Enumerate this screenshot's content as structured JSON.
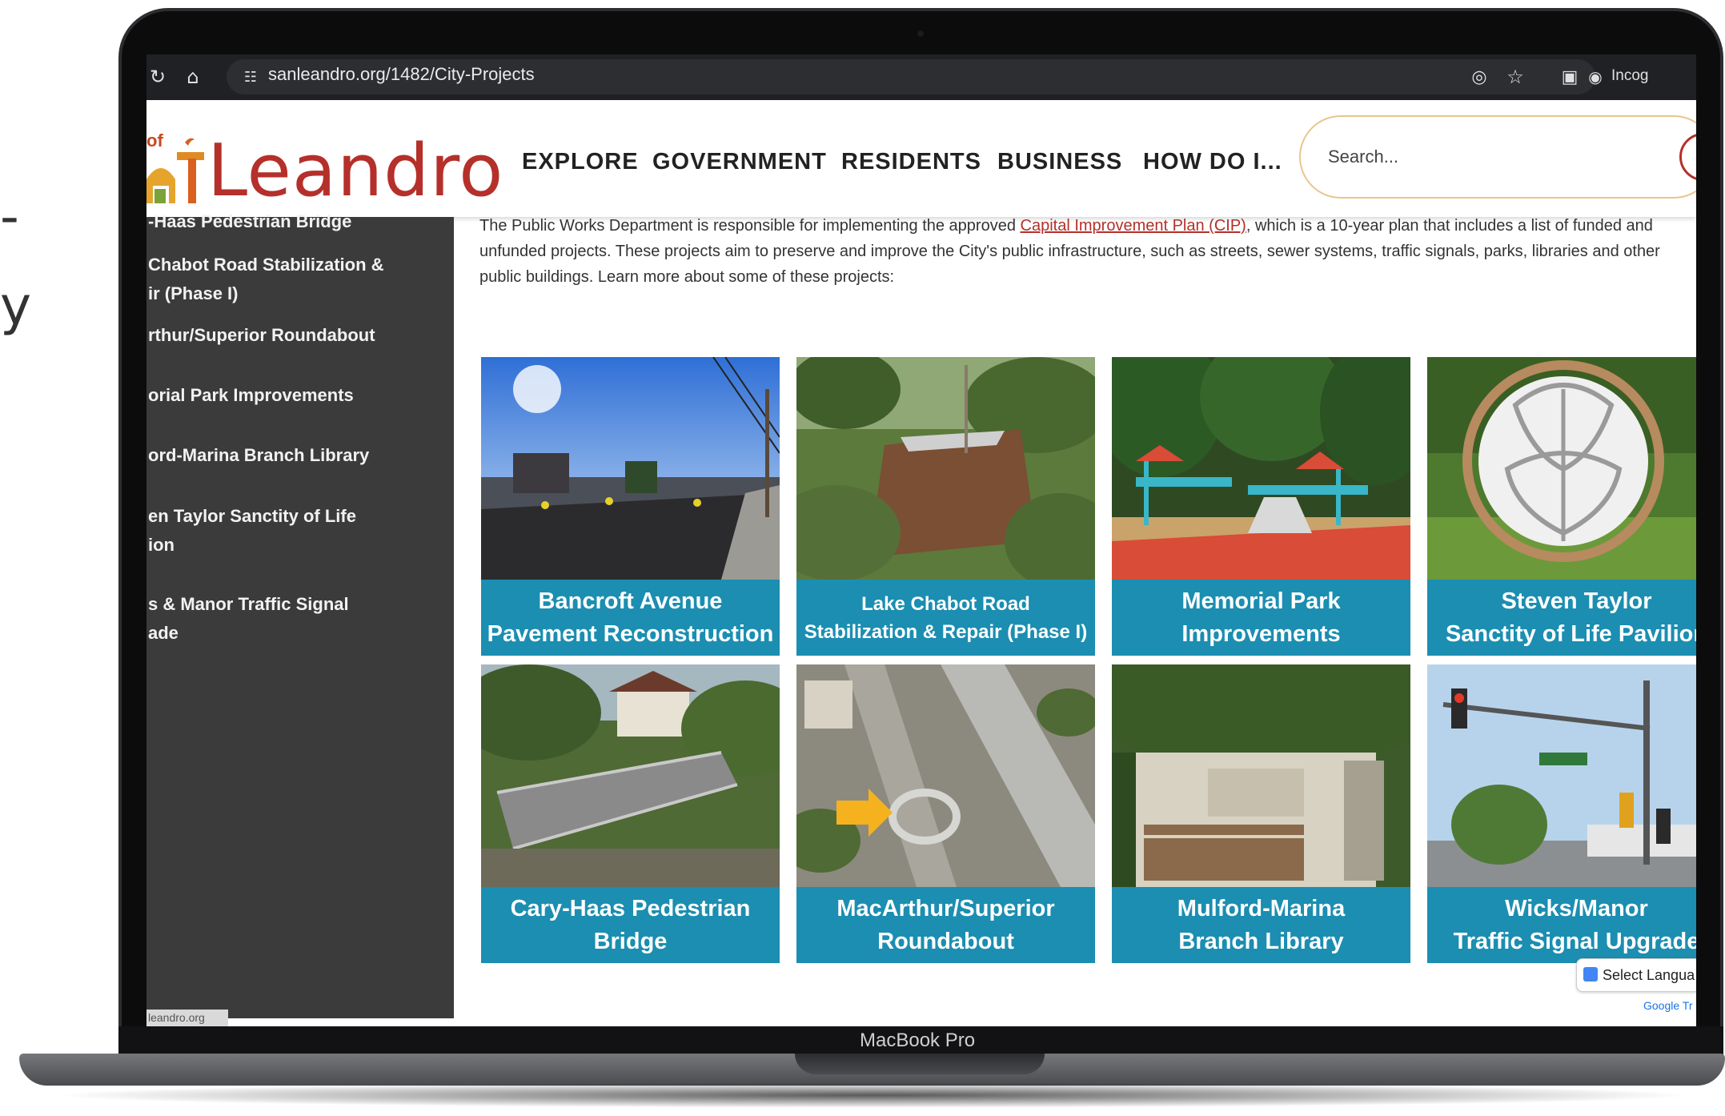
{
  "stray_text": {
    "line1": "-",
    "line2": "y"
  },
  "device": {
    "brand": "MacBook Pro"
  },
  "browser": {
    "url": "sanleandro.org/1482/City-Projects",
    "incognito_label": "Incog"
  },
  "site": {
    "logo_prefix": "of",
    "logo_text": "Leandro",
    "nav": [
      "EXPLORE",
      "GOVERNMENT",
      "RESIDENTS",
      "BUSINESS",
      "HOW DO I..."
    ],
    "search_placeholder": "Search..."
  },
  "sidebar": {
    "items": [
      {
        "lines": [
          "-Haas Pedestrian Bridge"
        ]
      },
      {
        "lines": [
          "Chabot Road Stabilization &",
          "ir (Phase I)"
        ]
      },
      {
        "lines": [
          "rthur/Superior Roundabout"
        ]
      },
      {
        "lines": [
          "orial Park Improvements"
        ]
      },
      {
        "lines": [
          "ord-Marina Branch Library"
        ]
      },
      {
        "lines": [
          "en Taylor Sanctity of Life",
          "ion"
        ]
      },
      {
        "lines": [
          "s & Manor Traffic Signal",
          "ade"
        ]
      }
    ],
    "status_url": "leandro.org"
  },
  "intro": {
    "before_link": "The Public Works Department is responsible for implementing the approved ",
    "link": "Capital Improvement Plan (CIP)",
    "after_link": ", which is a 10-year plan that includes a list of funded and unfunded projects. These projects aim to preserve and improve the City's public infrastructure, such as streets, sewer systems, traffic signals, parks, libraries and other public buildings. Learn more about some of these projects:"
  },
  "projects": [
    {
      "line1": "Bancroft Avenue",
      "line2": "Pavement Reconstruction"
    },
    {
      "line1": "Lake Chabot Road",
      "line2": "Stabilization & Repair (Phase I)"
    },
    {
      "line1": "Memorial Park",
      "line2": "Improvements"
    },
    {
      "line1": "Steven Taylor",
      "line2": "Sanctity of Life Pavilion"
    },
    {
      "line1": "Cary-Haas Pedestrian",
      "line2": "Bridge"
    },
    {
      "line1": "MacArthur/Superior",
      "line2": "Roundabout"
    },
    {
      "line1": "Mulford-Marina",
      "line2": "Branch Library"
    },
    {
      "line1": "Wicks/Manor",
      "line2": "Traffic Signal Upgrade"
    }
  ],
  "translate": {
    "label": "Select Langua",
    "powered": "Google Tr"
  }
}
